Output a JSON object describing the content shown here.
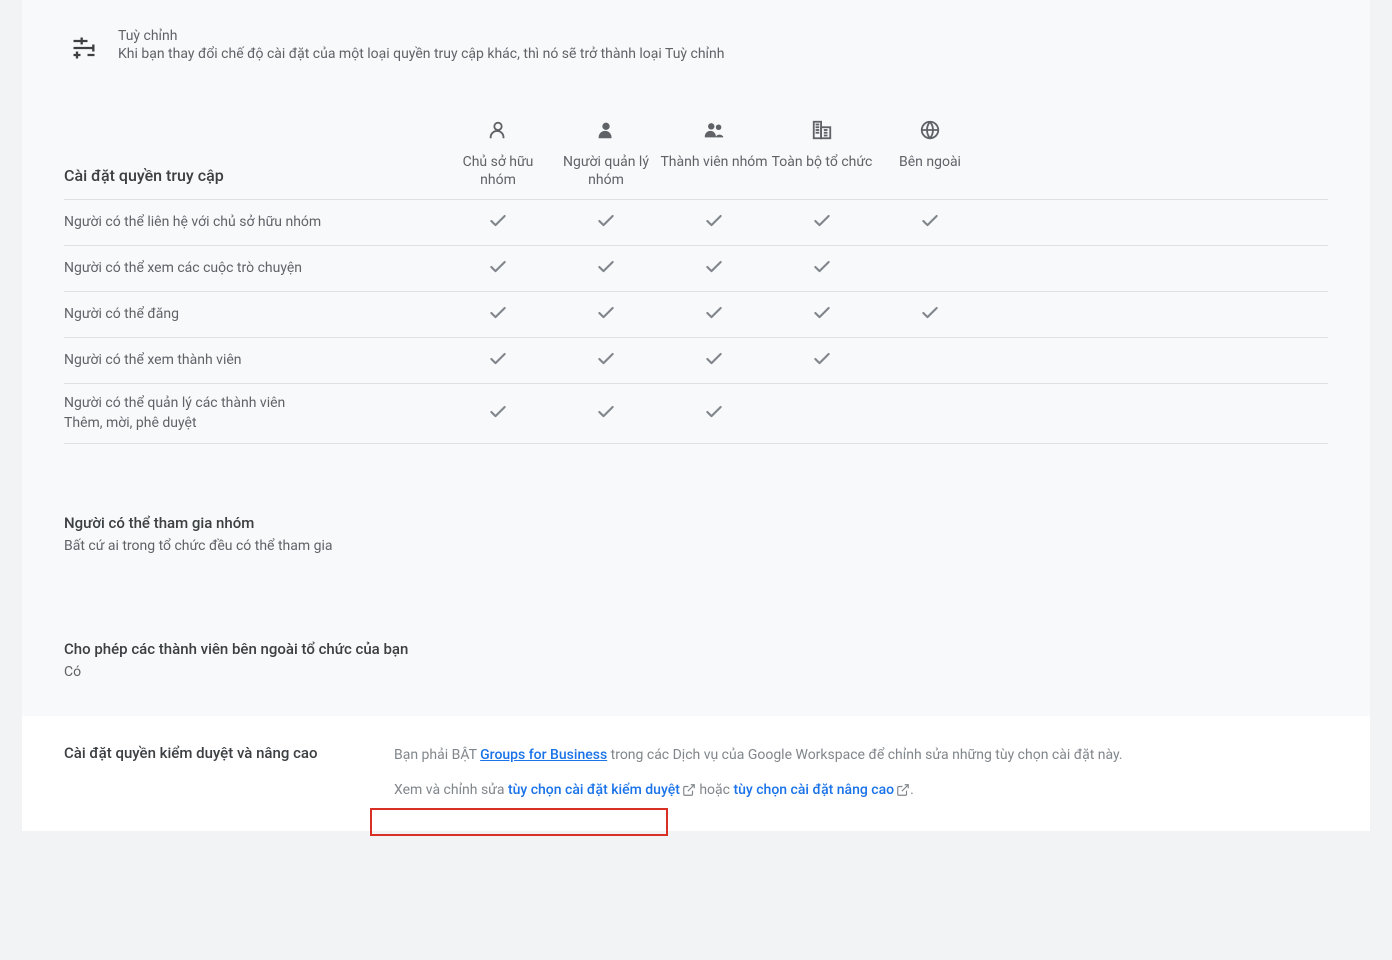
{
  "custom": {
    "title": "Tuỳ chỉnh",
    "subtitle": "Khi bạn thay đổi chế độ cài đặt của một loại quyền truy cập khác, thì nó sẽ trở thành loại Tuỳ chỉnh"
  },
  "matrix": {
    "heading": "Cài đặt quyền truy cập",
    "roles": [
      {
        "label": "Chủ sở hữu nhóm",
        "icon": "person-outline"
      },
      {
        "label": "Người quản lý nhóm",
        "icon": "person"
      },
      {
        "label": "Thành viên nhóm",
        "icon": "people"
      },
      {
        "label": "Toàn bộ tổ chức",
        "icon": "domain"
      },
      {
        "label": "Bên ngoài",
        "icon": "globe"
      }
    ],
    "rows": [
      {
        "label": "Người có thể liên hệ với chủ sở hữu nhóm",
        "checks": [
          true,
          true,
          true,
          true,
          true
        ]
      },
      {
        "label": "Người có thể xem các cuộc trò chuyện",
        "checks": [
          true,
          true,
          true,
          true,
          false
        ]
      },
      {
        "label": "Người có thể đăng",
        "checks": [
          true,
          true,
          true,
          true,
          true
        ]
      },
      {
        "label": "Người có thể xem thành viên",
        "checks": [
          true,
          true,
          true,
          true,
          false
        ]
      },
      {
        "label": "Người có thể quản lý các thành viên\nThêm, mời, phê duyệt",
        "checks": [
          true,
          true,
          true,
          false,
          false
        ]
      }
    ]
  },
  "join": {
    "title": "Người có thể tham gia nhóm",
    "value": "Bất cứ ai trong tổ chức đều có thể tham gia"
  },
  "external": {
    "title": "Cho phép các thành viên bên ngoài tổ chức của bạn",
    "value": "Có"
  },
  "footer": {
    "title": "Cài đặt quyền kiểm duyệt và nâng cao",
    "line1_pre": "Bạn phải BẬT ",
    "line1_link": "Groups for Business",
    "line1_post": " trong các Dịch vụ của Google Workspace để chỉnh sửa những tùy chọn cài đặt này.",
    "line2_pre": "Xem và chỉnh sửa ",
    "line2_link1": "tùy chọn cài đặt kiểm duyệt",
    "line2_mid": " hoặc ",
    "line2_link2": "tùy chọn cài đặt nâng cao",
    "line2_post": "."
  }
}
